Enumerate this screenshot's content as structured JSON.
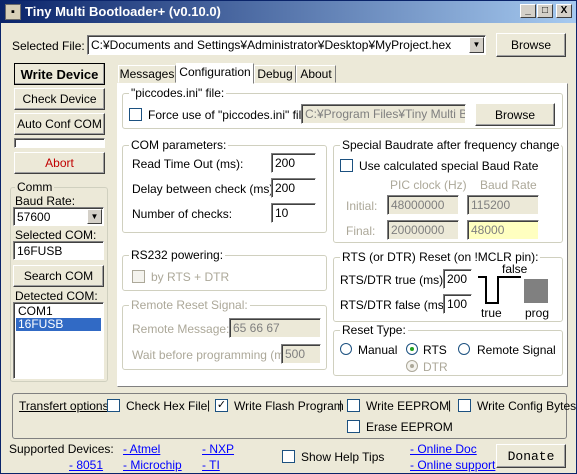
{
  "window": {
    "title": "Tiny Multi Bootloader+ (v0.10.0)",
    "minimize": "_",
    "maximize": "□",
    "close": "X"
  },
  "top": {
    "selected_file_label": "Selected File:",
    "selected_file_value": "C:¥Documents and Settings¥Administrator¥Desktop¥MyProject.hex",
    "browse_label": "Browse"
  },
  "left": {
    "write_device": "Write Device",
    "check_device": "Check Device",
    "auto_conf_com": "Auto Conf COM",
    "abort": "Abort",
    "comm_label": "Comm",
    "baud_rate_label": "Baud Rate:",
    "baud_rate_value": "57600",
    "selected_com_label": "Selected COM:",
    "selected_com_value": "16FUSB",
    "search_com": "Search COM",
    "detected_com_label": "Detected COM:",
    "detected_com": [
      "COM1",
      "16FUSB"
    ]
  },
  "tabs": [
    "Messages",
    "Configuration",
    "Debug",
    "About"
  ],
  "config": {
    "piccodes_group": "\"piccodes.ini\" file:",
    "force_use_label": "Force use of \"piccodes.ini\" file",
    "piccodes_path": "C:¥Program Files¥Tiny Multi Bootlo",
    "piccodes_browse": "Browse",
    "com_params_group": "COM parameters:",
    "read_timeout_label": "Read Time Out (ms):",
    "read_timeout_value": "200",
    "delay_check_label": "Delay between check (ms):",
    "delay_check_value": "200",
    "num_checks_label": "Number of checks:",
    "num_checks_value": "10",
    "special_baud_group": "Special Baudrate after frequency change",
    "use_calc_baud_label": "Use calculated special Baud Rate",
    "pic_clock_header": "PIC clock (Hz)",
    "baud_rate_header": "Baud Rate",
    "initial_label": "Initial:",
    "initial_clock": "48000000",
    "initial_baud": "115200",
    "final_label": "Final:",
    "final_clock": "20000000",
    "final_baud": "48000",
    "rs232_group": "RS232 powering:",
    "by_rts_dtr_label": "by RTS + DTR",
    "rts_reset_group": "RTS (or DTR) Reset (on !MCLR pin):",
    "rts_true_label": "RTS/DTR true (ms):",
    "rts_true_value": "200",
    "rts_false_label": "RTS/DTR false (ms):",
    "rts_false_value": "100",
    "diagram_false": "false",
    "diagram_true": "true",
    "diagram_prog": "prog",
    "remote_reset_group": "Remote Reset Signal:",
    "remote_message_label": "Remote Message:",
    "remote_message_value": "65 66 67",
    "wait_prog_label": "Wait before programming (ms):",
    "wait_prog_value": "500",
    "reset_type_group": "Reset Type:",
    "reset_manual": "Manual",
    "reset_rts": "RTS",
    "reset_remote": "Remote Signal",
    "reset_dtr": "DTR"
  },
  "transfer": {
    "label": "Transfert options:",
    "check_hex": "Check Hex File",
    "write_flash": "Write Flash Program",
    "write_eeprom": "Write EEPROM",
    "write_config": "Write Config Bytes",
    "erase_eeprom": "Erase EEPROM"
  },
  "footer": {
    "supported_devices": "Supported Devices:",
    "atmel": "- Atmel",
    "nxp": "- NXP",
    "d8051": "- 8051",
    "microchip": "- Microchip",
    "ti": "- TI",
    "show_help": "Show Help Tips",
    "online_doc": "- Online Doc",
    "online_support": "- Online support",
    "donate": "Donate"
  },
  "colors": {
    "title_start": "#0a246a",
    "title_end": "#a6caf0",
    "abort_text": "#c00000",
    "selection": "#316ac5"
  }
}
